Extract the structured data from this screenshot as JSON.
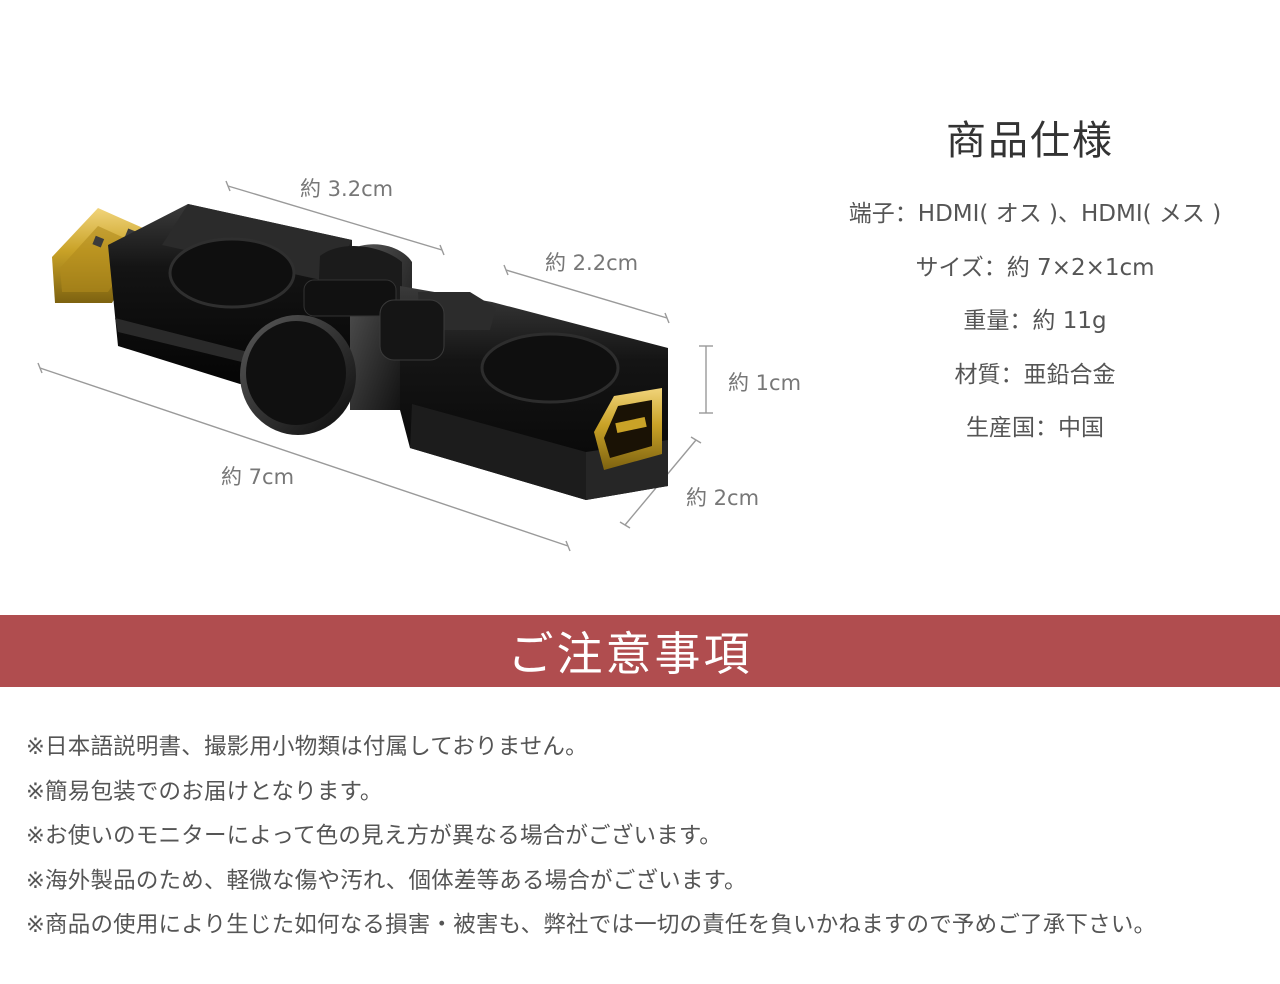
{
  "dimensions": {
    "top_width": "約 3.2cm",
    "connector_width": "約 2.2cm",
    "height": "約 1cm",
    "length": "約 7cm",
    "depth": "約 2cm"
  },
  "specs": {
    "title": "商品仕様",
    "items": [
      "端子：HDMI( オス )、HDMI( メス )",
      "サイズ：約 7×2×1cm",
      "重量：約 11g",
      "材質：亜鉛合金",
      "生産国：中国"
    ]
  },
  "notice": {
    "title": "ご注意事項",
    "items": [
      "※日本語説明書、撮影用小物類は付属しておりません。",
      "※簡易包装でのお届けとなります。",
      "※お使いのモニターによって色の見え方が異なる場合がございます。",
      "※海外製品のため、軽微な傷や汚れ、個体差等ある場合がございます。",
      "※商品の使用により生じた如何なる損害・被害も、弊社では一切の責任を負いかねますので予めご了承下さい。"
    ]
  },
  "colors": {
    "notice_bar": "#b04d4f",
    "adapter_body": "#151515",
    "gold_plug": "#c9a227"
  },
  "image": {
    "subject": "swivel HDMI adapter photo"
  }
}
